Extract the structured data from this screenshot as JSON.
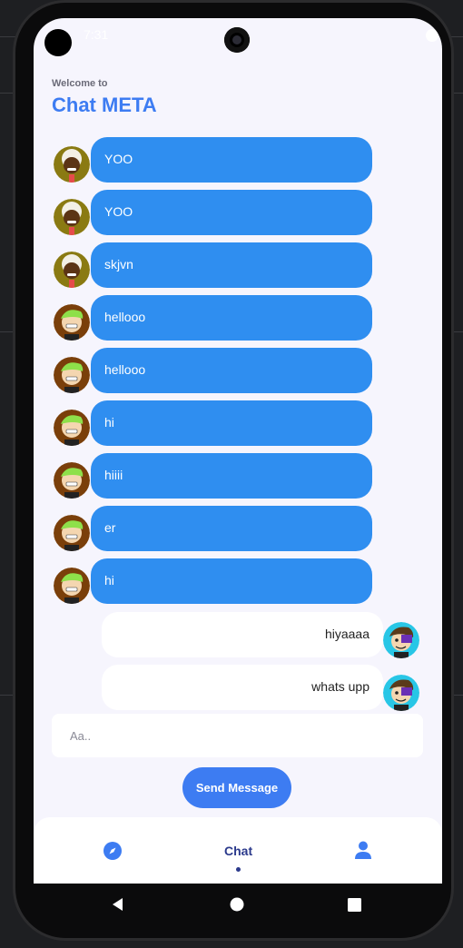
{
  "status_bar": {
    "time": "7:31"
  },
  "header": {
    "welcome": "Welcome to",
    "title": "Chat META"
  },
  "messages": [
    {
      "sender": "received",
      "avatar": "avatar-white-hair",
      "text": "YOO"
    },
    {
      "sender": "received",
      "avatar": "avatar-white-hair",
      "text": "YOO"
    },
    {
      "sender": "received",
      "avatar": "avatar-white-hair",
      "text": "skjvn"
    },
    {
      "sender": "received",
      "avatar": "avatar-green-hair",
      "text": "hellooo"
    },
    {
      "sender": "received",
      "avatar": "avatar-green-hair",
      "text": "hellooo"
    },
    {
      "sender": "received",
      "avatar": "avatar-green-hair",
      "text": "hi"
    },
    {
      "sender": "received",
      "avatar": "avatar-green-hair",
      "text": "hiiii"
    },
    {
      "sender": "received",
      "avatar": "avatar-green-hair",
      "text": "er"
    },
    {
      "sender": "received",
      "avatar": "avatar-green-hair",
      "text": "hi"
    },
    {
      "sender": "sent",
      "avatar": "avatar-purple-eye",
      "text": "hiyaaaa"
    },
    {
      "sender": "sent",
      "avatar": "avatar-purple-eye",
      "text": "whats upp"
    }
  ],
  "composer": {
    "placeholder": "Aa..",
    "send_label": "Send Message"
  },
  "bottom_nav": {
    "items": [
      {
        "icon": "compass-icon",
        "label": ""
      },
      {
        "icon": "",
        "label": "Chat"
      },
      {
        "icon": "person-icon",
        "label": ""
      }
    ]
  },
  "colors": {
    "accent": "#3d7cf2",
    "bubble_received": "#2f8ef0",
    "bubble_sent": "#ffffff",
    "background": "#f6f5fd",
    "nav_active": "#2b3a8c"
  }
}
